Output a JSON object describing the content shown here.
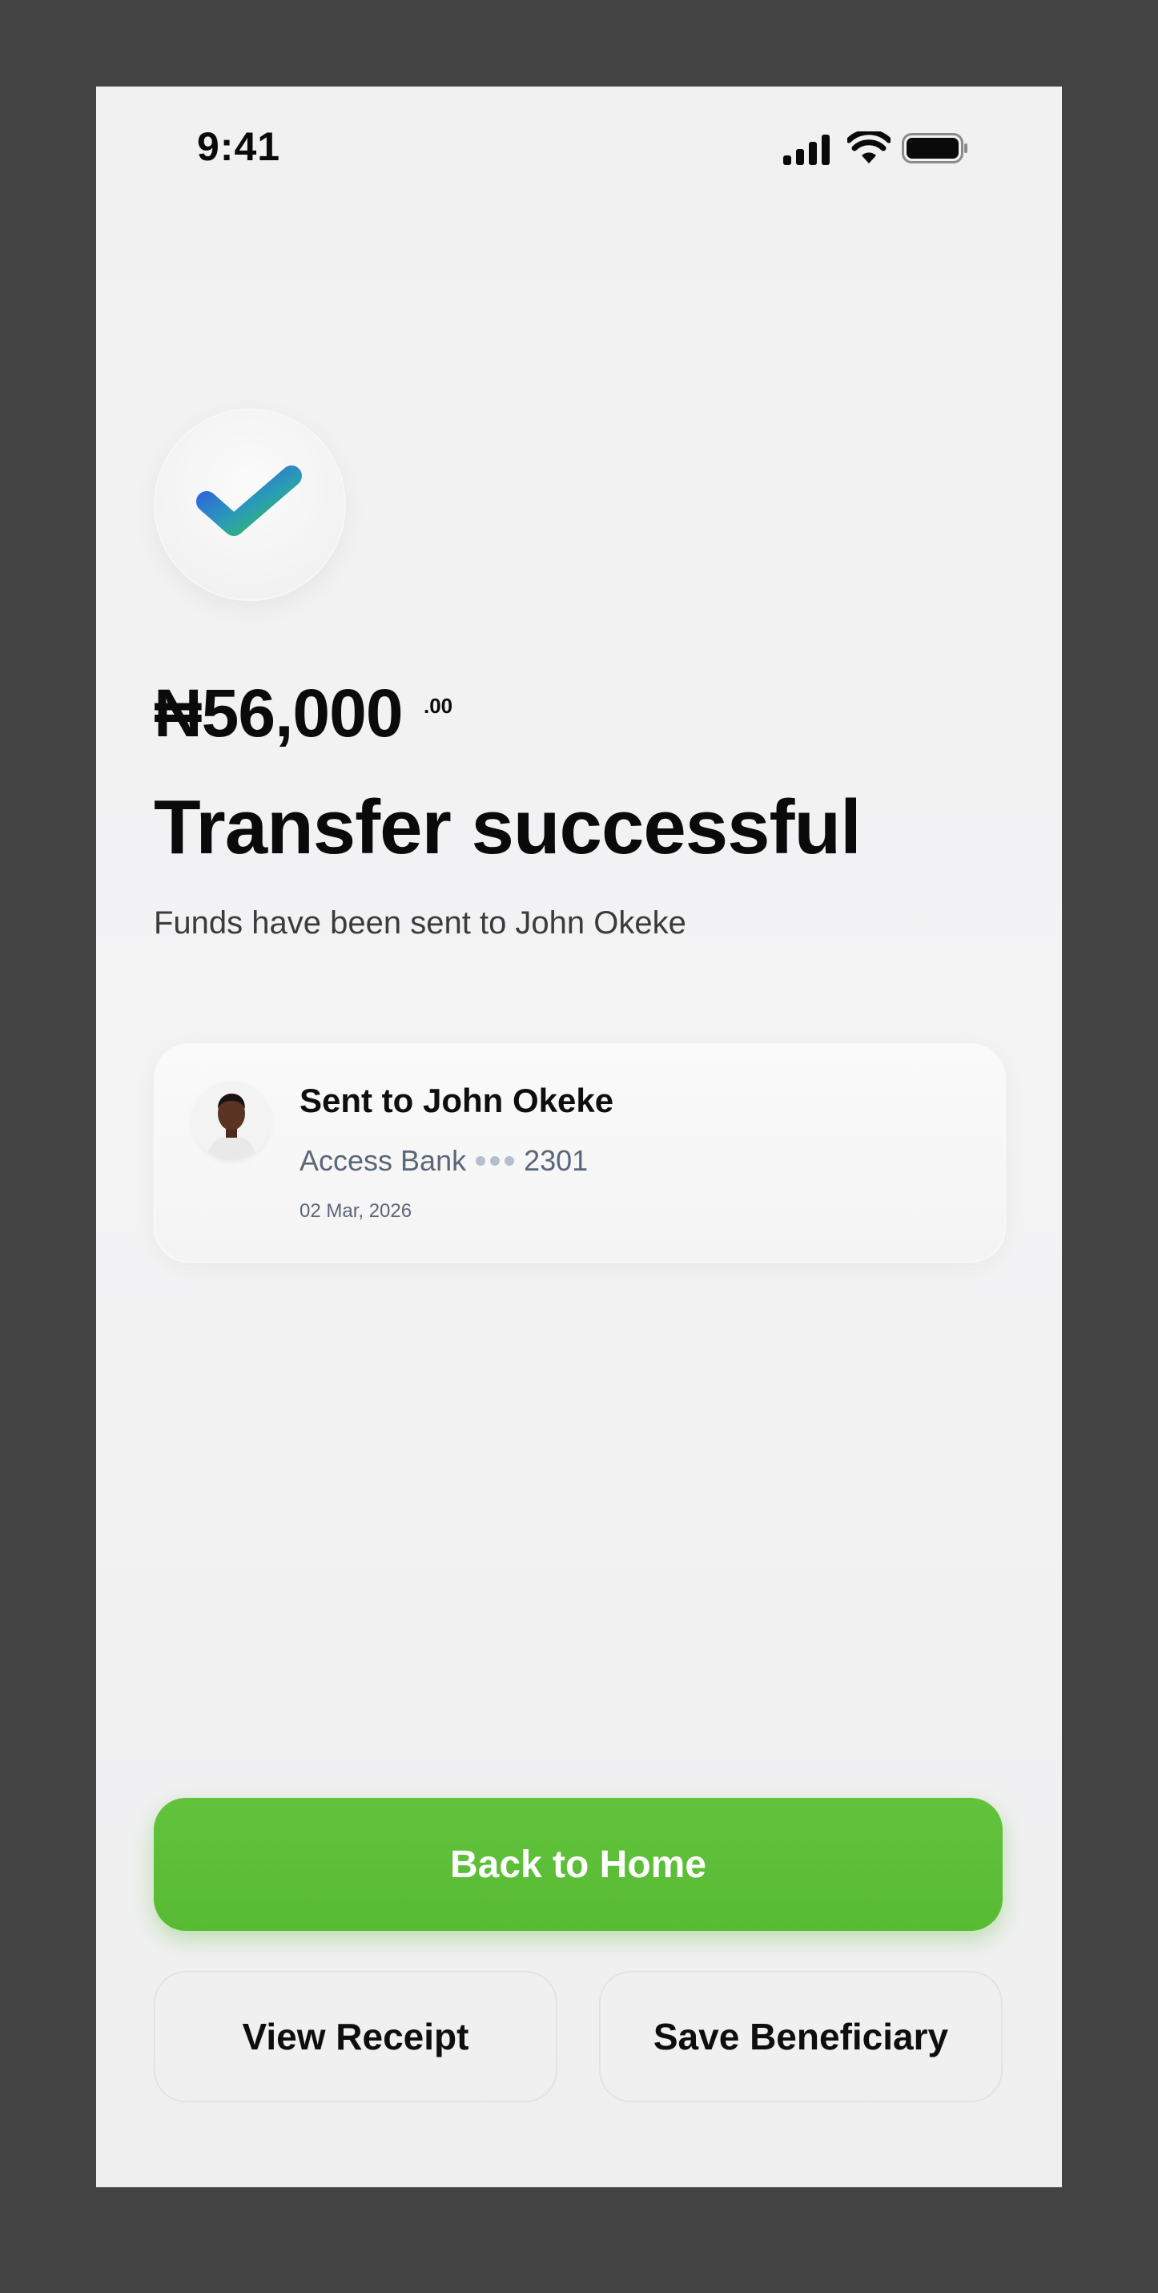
{
  "status_bar": {
    "time": "9:41",
    "icons": [
      "signal-icon",
      "wifi-icon",
      "battery-icon"
    ]
  },
  "success": {
    "icon": "checkmark-icon",
    "amount": "₦56,000",
    "amount_cents": ".00",
    "title": "Transfer successful",
    "subtitle": "Funds have been sent to John Okeke"
  },
  "recipient_card": {
    "title": "Sent to John Okeke",
    "bank": "Access Bank",
    "account_last4": "2301",
    "date": "02 Mar, 2026"
  },
  "actions": {
    "primary": "Back to Home",
    "receipt": "View Receipt",
    "save": "Save Beneficiary"
  },
  "colors": {
    "primary_button": "#5cbf38",
    "background": "#f2f2f3",
    "frame": "#434343",
    "muted_text": "#5a6778"
  }
}
